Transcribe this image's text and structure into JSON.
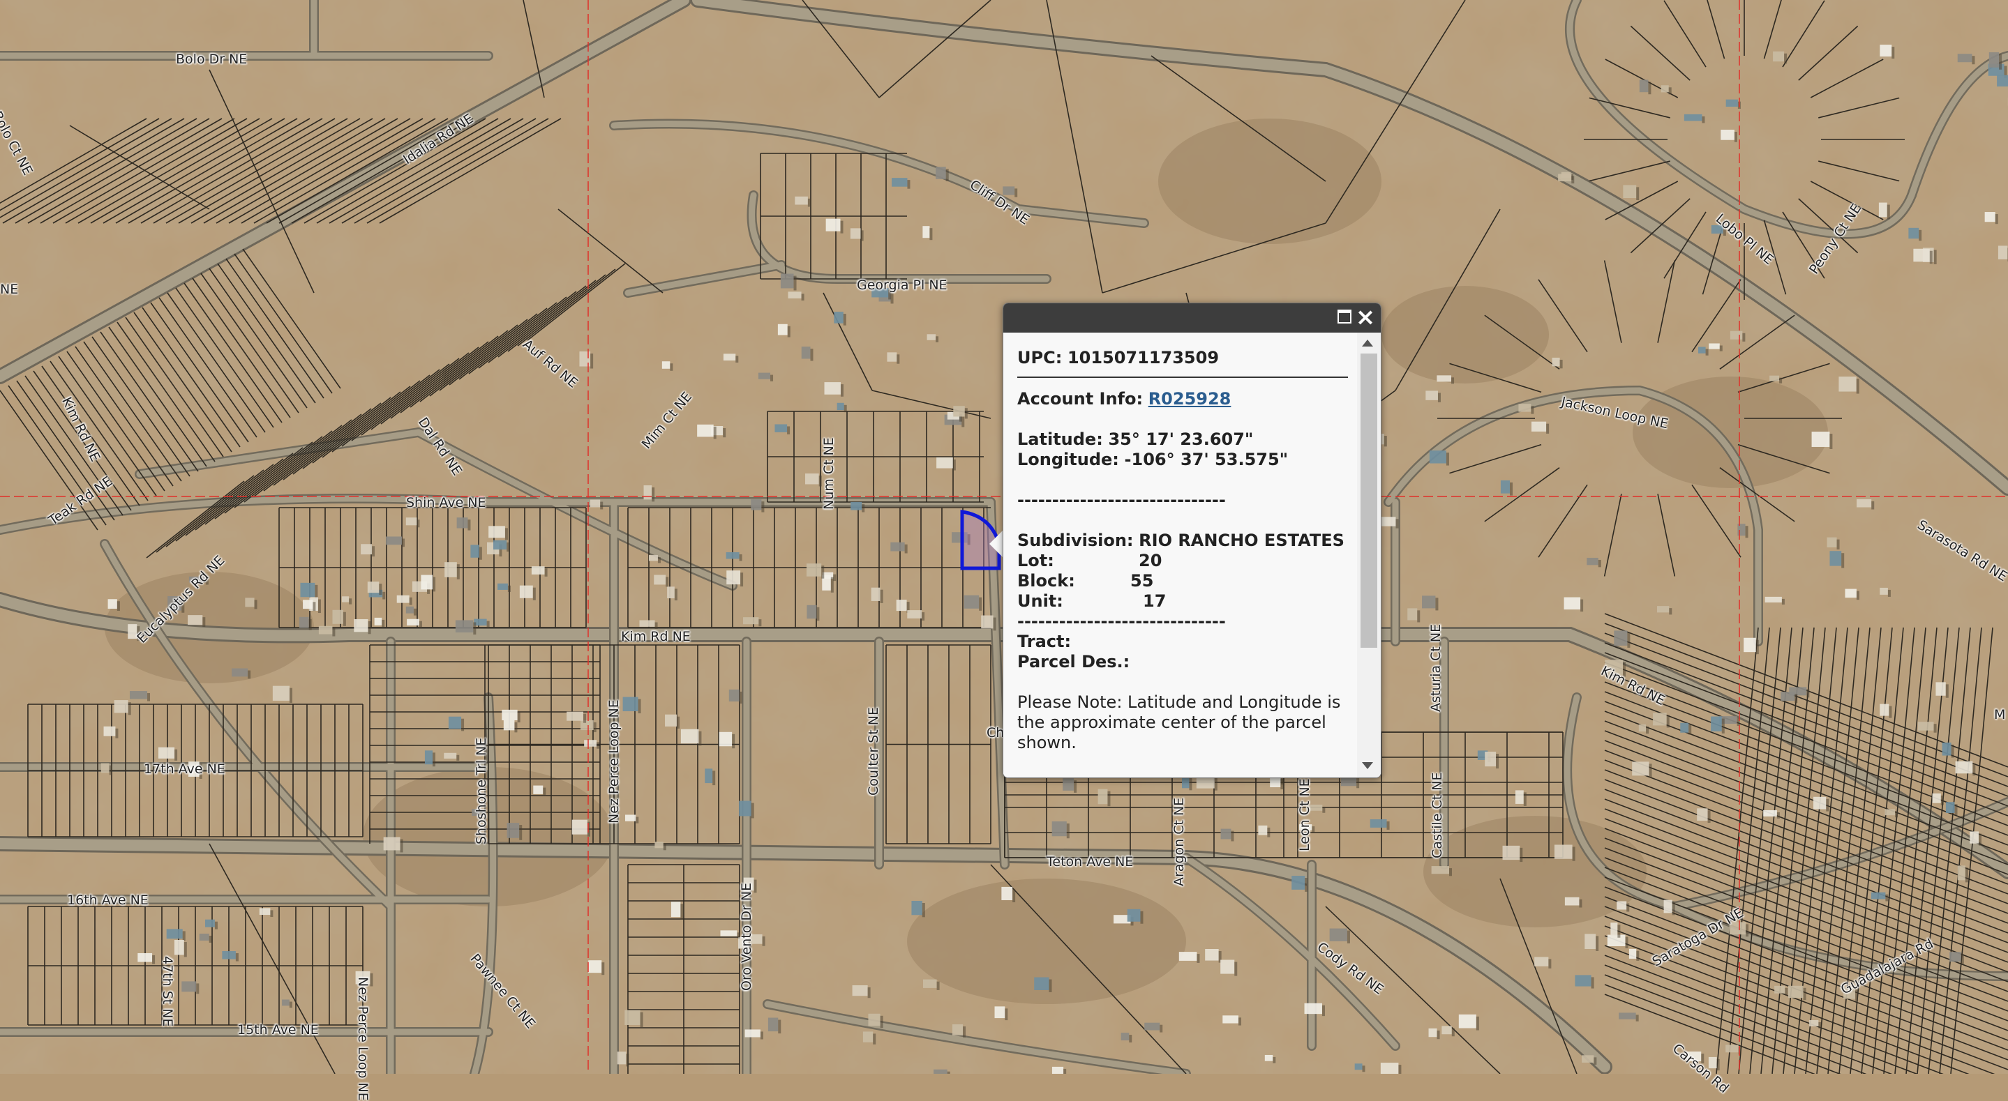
{
  "colors": {
    "terrain": "#b59a76",
    "road_fill": "#a39a86",
    "road_edge": "#6b6558",
    "parcel_line": "#2f2a22",
    "grid_line": "#e0302a",
    "selected_parcel": "#1018d8"
  },
  "popup": {
    "maximize_icon": "maximize-icon",
    "close_icon": "close-icon",
    "upc_label": "UPC:",
    "upc_value": "1015071173509",
    "account_label": "Account Info:",
    "account_value": "R025928",
    "latitude_label": "Latitude:",
    "latitude_value": "35° 17' 23.607\"",
    "longitude_label": "Longitude:",
    "longitude_value": "-106° 37' 53.575\"",
    "separator": "------------------------------",
    "subdivision_label": "Subdivision:",
    "subdivision_value": "RIO RANCHO ESTATES",
    "lot_label": "Lot:",
    "lot_value": "20",
    "block_label": "Block:",
    "block_value": "55",
    "unit_label": "Unit:",
    "unit_value": "17",
    "tract_label": "Tract:",
    "parcel_des_label": "Parcel Des.:",
    "note": "Please Note: Latitude and Longitude is the approximate center of the parcel shown."
  },
  "street_labels": {
    "bolo_dr": "Bolo Dr NE",
    "bolo_ct": "Bolo Ct NE",
    "idalia_rd": "Idalia Rd NE",
    "cliff_dr": "Cliff Dr NE",
    "georgia_pl": "Georgia Pl NE",
    "auf_rd": "Auf Rd NE",
    "mim_ct": "Mim Ct NE",
    "num_ct": "Num Ct NE",
    "dal_rd": "Dal Rd NE",
    "kim_rd_left": "Kim Rd NE",
    "teak_rd": "Teak Rd NE",
    "shin_ave": "Shin Ave NE",
    "eucalyptus_rd": "Eucalyptus Rd NE",
    "kim_rd_mid": "Kim Rd NE",
    "kim_rd_right": "Kim Rd NE",
    "jackson_loop": "Jackson Loop NE",
    "lobo_pl": "Lobo Pl NE",
    "peony_ct": "Peony Ct NE",
    "sarasota_rd": "Sarasota Rd NE",
    "asturia_ct": "Asturia Ct NE",
    "seventeenth_ave": "17th Ave NE",
    "shoshone_trl": "Shoshone Trl NE",
    "nez_perce_loop": "Nez Perce Loop NE",
    "coulter_st": "Coulter St NE",
    "sixteenth_ave": "16th Ave NE",
    "fortyseventh_st": "47th St NE",
    "pawnee_ct": "Pawnee Ct NE",
    "nez_perce_loop_2": "Nez Perce Loop NE",
    "fifteenth_ave": "15th Ave NE",
    "oro_vento_dr": "Oro Vento Dr NE",
    "teton_ave": "Teton Ave NE",
    "aragon_ct": "Aragon Ct NE",
    "leon_ct": "Leon Ct NE",
    "castile_ct": "Castile Ct NE",
    "cody_rd": "Cody Rd NE",
    "saratoga_dr": "Saratoga Dr NE",
    "guadalajara_rd": "Guadalajara Rd",
    "carson_rd": "Carson Rd",
    "partial_label": "Ch",
    "edge_ne": "NE",
    "edge_m": "M"
  }
}
